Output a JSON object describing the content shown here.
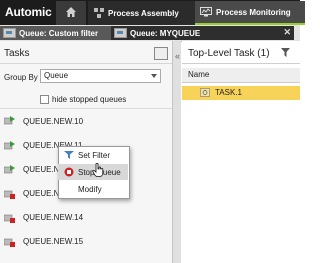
{
  "brand": {
    "name": "Automic"
  },
  "topnav": {
    "tabs": [
      {
        "label": "Process Assembly",
        "icon": "process-assembly-icon"
      },
      {
        "label": "Process Monitoring",
        "icon": "process-monitoring-icon"
      }
    ]
  },
  "subtabs": [
    {
      "label": "Queue: Custom filter"
    },
    {
      "label": "Queue: MYQUEUE"
    }
  ],
  "left": {
    "title": "Tasks",
    "group_by_label": "Group By",
    "group_by_value": "Queue",
    "hide_stopped_label": "hide stopped queues",
    "queues": [
      "QUEUE.NEW.10",
      "QUEUE.NEW.11",
      "QUEUE.NEW.12",
      "QUEUE.NEW.13",
      "QUEUE.NEW.14",
      "QUEUE.NEW.15"
    ]
  },
  "right": {
    "title": "Top-Level Task (1)",
    "column_name": "Name",
    "rows": [
      "TASK.1"
    ]
  },
  "context_menu": {
    "items": [
      "Set Filter",
      "Stop Queue",
      "Modify"
    ]
  },
  "colors": {
    "selected_row": "#f7d35a",
    "accent": "#9acd32",
    "stop": "#cc2222"
  }
}
